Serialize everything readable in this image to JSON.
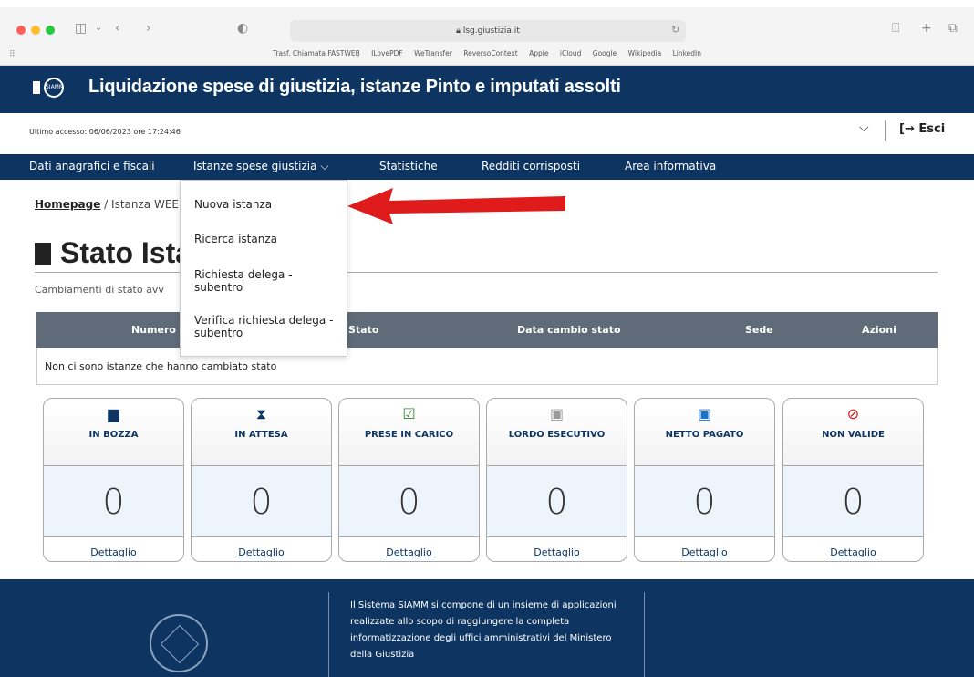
{
  "browser": {
    "url": "lsg.giustizia.it",
    "bookmarks": [
      "Trasf. Chiamata FASTWEB",
      "ILovePDF",
      "WeTransfer",
      "ReversoContext",
      "Apple",
      "iCloud",
      "Google",
      "Wikipedia",
      "LinkedIn"
    ]
  },
  "header": {
    "logo_text": "SIAMM",
    "title": "Liquidazione spese di giustizia, istanze Pinto e imputati assolti"
  },
  "session": {
    "last_access": "Ultimo accesso: 06/06/2023 ore 17:24:46",
    "logout_label": "Esci"
  },
  "nav": {
    "items": [
      "Dati anagrafici e fiscali",
      "Istanze spese giustizia",
      "Statistiche",
      "Redditi corrisposti",
      "Area informativa"
    ]
  },
  "dropdown": {
    "items": [
      "Nuova istanza",
      "Ricerca istanza",
      "Richiesta delega - subentro",
      "Verifica richiesta delega - subentro"
    ]
  },
  "breadcrumb": {
    "home": "Homepage",
    "current": "Istanza WEE"
  },
  "page": {
    "title": "Stato Ista",
    "subtitle": "Cambiamenti di stato avv"
  },
  "table": {
    "headers": [
      "Numero",
      "Stato",
      "Data cambio stato",
      "Sede",
      "Azioni"
    ],
    "empty_message": "Non ci sono istanze che hanno cambiato stato"
  },
  "cards": [
    {
      "label": "IN BOZZA",
      "count": "0",
      "link": "Dettaglio",
      "icon": "document-icon"
    },
    {
      "label": "IN ATTESA",
      "count": "0",
      "link": "Dettaglio",
      "icon": "hourglass-icon"
    },
    {
      "label": "PRESE IN CARICO",
      "count": "0",
      "link": "Dettaglio",
      "icon": "calendar-check-icon"
    },
    {
      "label": "LORDO ESECUTIVO",
      "count": "0",
      "link": "Dettaglio",
      "icon": "banknote-icon"
    },
    {
      "label": "NETTO PAGATO",
      "count": "0",
      "link": "Dettaglio",
      "icon": "money-check-icon"
    },
    {
      "label": "NON VALIDE",
      "count": "0",
      "link": "Dettaglio",
      "icon": "ban-icon"
    }
  ],
  "footer": {
    "text": "Il Sistema SIAMM si compone di un insieme di applicazioni realizzate allo scopo di raggiungere la completa informatizzazione degli uffici amministrativi del Ministero della Giustizia"
  },
  "colors": {
    "brand": "#0e3562",
    "table_header": "#5f6b78",
    "arrow": "#e01b1b",
    "card_count_bg": "#eef4fb"
  }
}
